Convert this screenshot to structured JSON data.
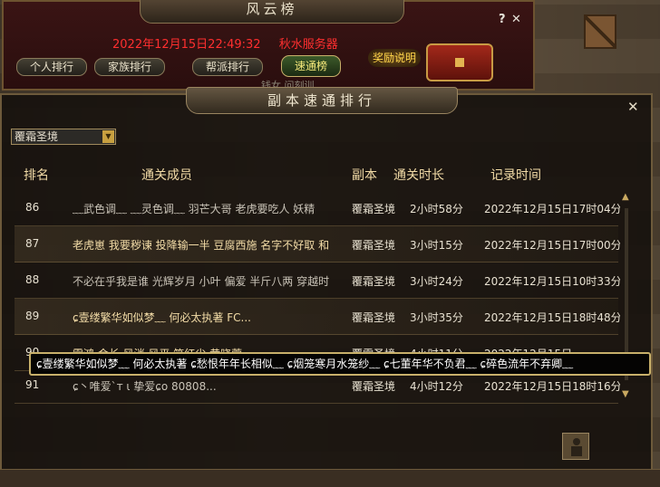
{
  "back_window": {
    "title": "风云榜",
    "help": "?",
    "close": "✕",
    "datetime": "2022年12月15日22:49:32",
    "server": "秋水服务器",
    "tabs": [
      "个人排行",
      "家族排行",
      "帮派排行",
      "速通榜"
    ],
    "reward_label": "奖励说明",
    "faded_text": "钱女  问刻训"
  },
  "panel": {
    "title": "副本速通排行",
    "close": "✕",
    "dropdown_value": "覆霜圣境",
    "headers": {
      "rank": "排名",
      "members": "通关成员",
      "dungeon": "副本",
      "time": "通关时长",
      "record": "记录时间"
    },
    "rows": [
      {
        "rank": "86",
        "members": "﹏武色调﹏ ﹏灵色调﹏ 羽芒大哥 老虎要吃人 妖精",
        "dungeon": "覆霜圣境",
        "time": "2小时58分",
        "record": "2022年12月15日17时04分"
      },
      {
        "rank": "87",
        "members": "老虎崽 我要秽谏 投降输一半 豆腐西施 名字不好取 和",
        "dungeon": "覆霜圣境",
        "time": "3小时15分",
        "record": "2022年12月15日17时00分"
      },
      {
        "rank": "88",
        "members": "不必在乎我是谁 光辉岁月 小叶 偏爱 半斤八两 穿越时",
        "dungeon": "覆霜圣境",
        "time": "3小时24分",
        "record": "2022年12月15日10时33分"
      },
      {
        "rank": "89",
        "members": "ɕ壹缕繁华如似梦﹏ 何必太执著 FC...",
        "dungeon": "覆霜圣境",
        "time": "3小时35分",
        "record": "2022年12月15日18时48分"
      },
      {
        "rank": "90",
        "members": "震鸿 会长 风消 风平 笑红尘 黄晓萱",
        "dungeon": "覆霜圣境",
        "time": "4小时11分",
        "record": "2022年12月15日..."
      },
      {
        "rank": "91",
        "members": "ɕ丶唯爱`ᴛ ι 挚爱ɕo 80808...",
        "dungeon": "覆霜圣境",
        "time": "4小时12分",
        "record": "2022年12月15日18时16分"
      }
    ],
    "tooltip": "ɕ壹缕繁华如似梦﹏ 何必太执著 ɕ愁恨年年长相似﹏ ɕ烟笼寒月水笼纱﹏ ɕ七董年华不负君﹏ ɕ碎色流年不弃卿﹏"
  },
  "colors": {
    "header": "#f3dca7",
    "server_red": "#ff2f2f",
    "tooltip_border": "#c8b06a"
  }
}
